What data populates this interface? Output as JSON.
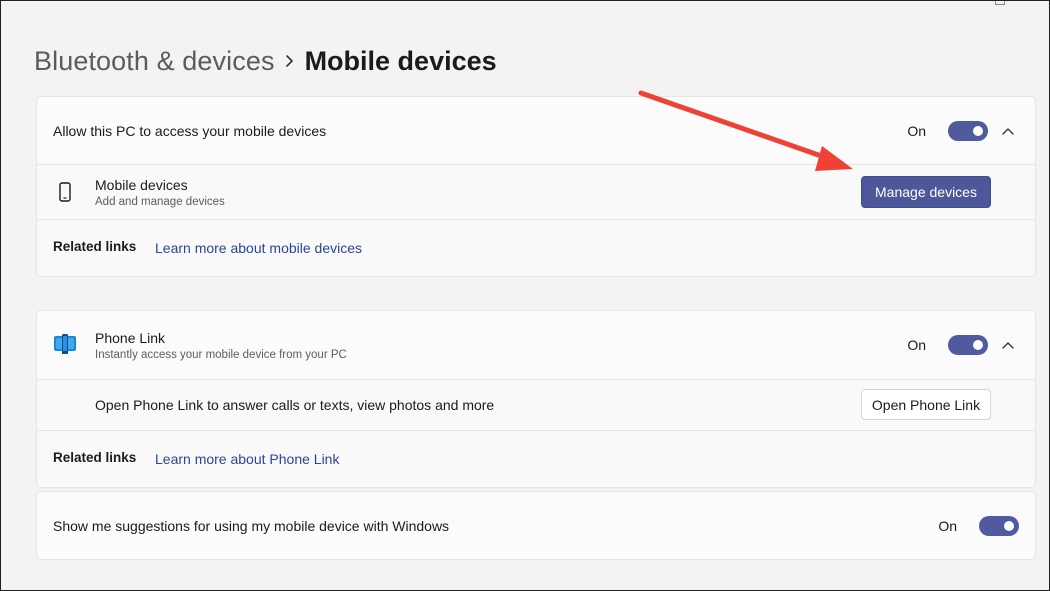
{
  "breadcrumb": {
    "parent": "Bluetooth & devices",
    "current": "Mobile devices"
  },
  "mobile_card": {
    "header_label": "Allow this PC to access your mobile devices",
    "toggle_state": "On",
    "toggle_on": true,
    "item_title": "Mobile devices",
    "item_desc": "Add and manage devices",
    "item_icon": "phone-icon",
    "button_label": "Manage devices",
    "related_label": "Related links",
    "related_link": "Learn more about mobile devices"
  },
  "phone_link_card": {
    "title": "Phone Link",
    "desc": "Instantly access your mobile device from your PC",
    "icon": "phone-link-app-icon",
    "toggle_state": "On",
    "toggle_on": true,
    "open_row_label": "Open Phone Link to answer calls or texts, view photos and more",
    "button_label": "Open Phone Link",
    "related_label": "Related links",
    "related_link": "Learn more about Phone Link"
  },
  "suggestions_card": {
    "label": "Show me suggestions for using my mobile device with Windows",
    "toggle_state": "On",
    "toggle_on": true
  },
  "colors": {
    "accent": "#4f5a9f",
    "link": "#2b4696",
    "annotation_arrow": "#ef4136"
  }
}
